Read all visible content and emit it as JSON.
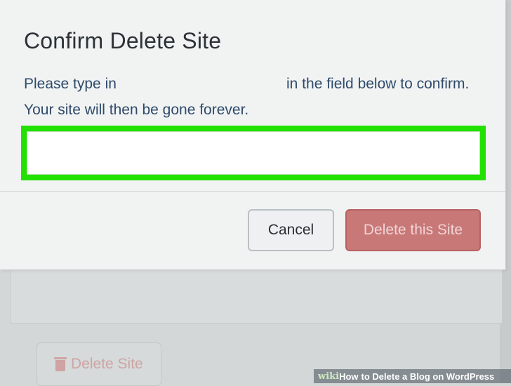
{
  "dialog": {
    "title": "Confirm Delete Site",
    "instruction_before": "Please type in",
    "instruction_after": "in the field below to confirm.",
    "warning": "Your site will then be gone forever.",
    "input_value": "",
    "highlight_color": "#22e000",
    "cancel_label": "Cancel",
    "delete_label": "Delete this Site",
    "delete_color": "#c97878"
  },
  "background": {
    "delete_site_label": "Delete Site",
    "delete_site_icon": "trash-icon"
  },
  "watermark": {
    "brand": "wiki",
    "how": "How",
    "text": "to Delete a Blog on WordPress"
  }
}
